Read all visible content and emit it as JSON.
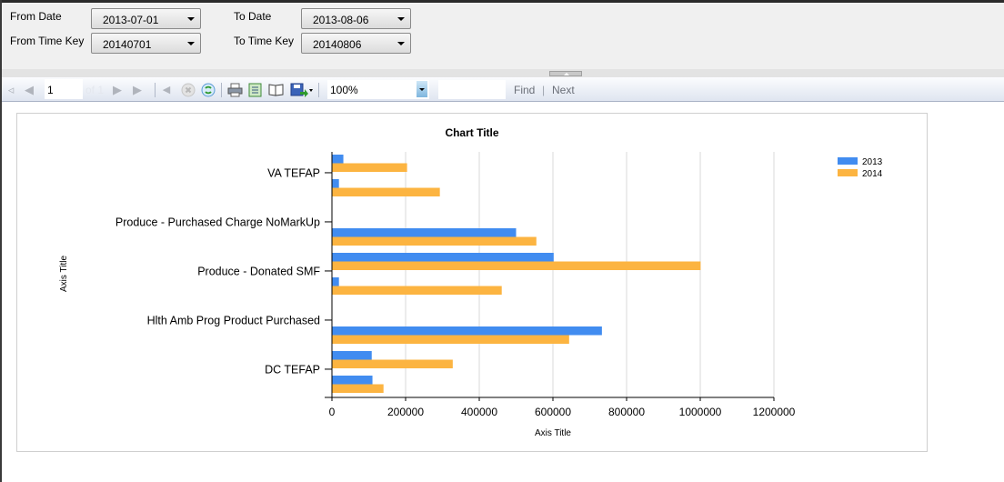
{
  "parameters": {
    "from_date": {
      "label": "From Date",
      "value": "2013-07-01"
    },
    "to_date": {
      "label": "To Date",
      "value": "2013-08-06"
    },
    "from_time_key": {
      "label": "From Time Key",
      "value": "20140701"
    },
    "to_time_key": {
      "label": "To Time Key",
      "value": "20140806"
    }
  },
  "toolbar": {
    "page_number": "1",
    "page_of": "of 1",
    "zoom_value": "100%",
    "find_label": "Find",
    "separator": "|",
    "next_label": "Next",
    "icons": [
      "first-page-icon",
      "previous-page-icon",
      "next-page-icon",
      "last-page-icon",
      "back-icon",
      "stop-icon",
      "refresh-icon",
      "print-icon",
      "page-setup-icon",
      "print-layout-icon",
      "export-icon"
    ]
  },
  "colors": {
    "series_2013": "#418CF0",
    "series_2014": "#FCB441"
  },
  "chart_data": {
    "type": "bar",
    "orientation": "horizontal",
    "title": "Chart Title",
    "xlabel": "Axis Title",
    "ylabel": "Axis Title",
    "xlim": [
      0,
      1200000
    ],
    "xticks": [
      "0",
      "200000",
      "400000",
      "600000",
      "800000",
      "1000000",
      "1200000"
    ],
    "grid": true,
    "legend_position": "top-right",
    "categories": [
      "VA TEFAP",
      "",
      "Produce - Purchased Charge NoMarkUp",
      "",
      "Produce - Donated SMF",
      "",
      "Hlth Amb Prog Product Purchased",
      "",
      "DC TEFAP",
      ""
    ],
    "series": [
      {
        "name": "2013",
        "values": [
          31000,
          19000,
          0,
          500000,
          602000,
          19000,
          0,
          733000,
          108000,
          110000
        ]
      },
      {
        "name": "2014",
        "values": [
          204000,
          293000,
          0,
          555000,
          1001000,
          461000,
          0,
          644000,
          328000,
          140000
        ]
      }
    ]
  }
}
